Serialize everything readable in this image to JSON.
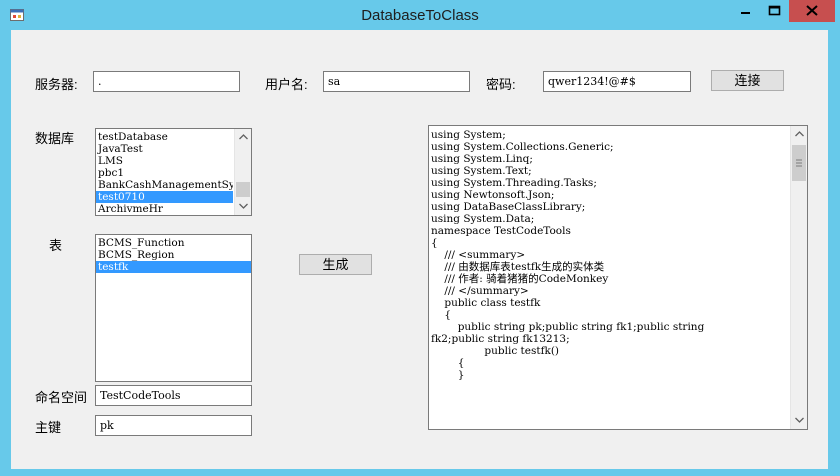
{
  "window": {
    "title": "DatabaseToClass"
  },
  "connection": {
    "server_label": "服务器:",
    "server_value": ".",
    "user_label": "用户名:",
    "user_value": "sa",
    "password_label": "密码:",
    "password_value": "qwer1234!@#$",
    "connect_button": "连接"
  },
  "database": {
    "label": "数据库",
    "items": [
      "testDatabase",
      "JavaTest",
      "LMS",
      "pbc1",
      "BankCashManagementSystem",
      "test0710",
      "ArchivmeHr"
    ],
    "selected_index": 5
  },
  "tables": {
    "label": "表",
    "items": [
      "BCMS_Function",
      "BCMS_Region",
      "testfk"
    ],
    "selected_index": 2
  },
  "generate_button": "生成",
  "namespace": {
    "label": "命名空间",
    "value": "TestCodeTools"
  },
  "primary_key": {
    "label": "主键",
    "value": "pk"
  },
  "code_output": {
    "lines": [
      "using System;",
      "using System.Collections.Generic;",
      "using System.Linq;",
      "using System.Text;",
      "using System.Threading.Tasks;",
      "using Newtonsoft.Json;",
      "using DataBaseClassLibrary;",
      "using System.Data;",
      "",
      "namespace TestCodeTools",
      "{",
      "    /// <summary>",
      "    /// 由数据库表testfk生成的实体类",
      "    /// 作者: 骑着猪猪的CodeMonkey",
      "    /// </summary>",
      "    public class testfk",
      "    {",
      "        public string pk;public string fk1;public string",
      "fk2;public string fk13213;",
      "",
      "                public testfk()",
      "        {",
      "",
      "        }"
    ]
  },
  "colors": {
    "titlebar": "#67c9ea",
    "close_button": "#c74f4f",
    "selection": "#3399ff",
    "client": "#f0f0f0"
  }
}
